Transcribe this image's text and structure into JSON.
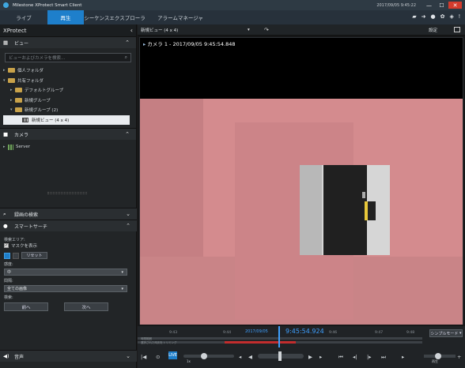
{
  "window": {
    "title": "Milestone XProtect Smart Client",
    "clock": "2017/09/05 9:45:22",
    "minimize_glyph": "—",
    "maximize_glyph": "☐",
    "close_glyph": "✕"
  },
  "tabs": [
    "ライブ",
    "再生",
    "シーケンスエクスプローラ",
    "アラームマネージャ"
  ],
  "active_tab": "再生",
  "top_icons": [
    "layout-icon",
    "arrow-icon",
    "help-icon",
    "gear-icon",
    "status-icon",
    "info-icon"
  ],
  "sidebar": {
    "title": "XProtect",
    "collapse_glyph": "‹",
    "views": {
      "header": "ビュー",
      "search_placeholder": "ビューおよびカメラを検索...",
      "tree": [
        {
          "label": "個人フォルダ",
          "level": 0
        },
        {
          "label": "共有フォルダ",
          "level": 0
        },
        {
          "label": "デフォルトグループ",
          "level": 1
        },
        {
          "label": "新規グループ",
          "level": 1
        },
        {
          "label": "新規グループ (2)",
          "level": 1
        },
        {
          "label": "新規ビュー (4 x 4)",
          "level": 2,
          "selected": true
        }
      ]
    },
    "cameras": {
      "header": "カメラ",
      "tree": [
        {
          "label": "Server",
          "level": 0
        }
      ]
    },
    "export": {
      "header": "録画の検索"
    },
    "smart_search": {
      "header": "スマートサーチ",
      "search_area_label": "検索エリア:",
      "show_mask_label": "マスクを表示",
      "show_mask_checked": true,
      "reset_label": "リセット",
      "sensitivity_label": "感度:",
      "sensitivity_value": "中",
      "interval_label": "間隔:",
      "interval_value": "全ての画像",
      "search_label": "検索:",
      "prev_label": "前へ",
      "next_label": "次へ"
    },
    "audio": {
      "header": "音声"
    }
  },
  "viewer": {
    "view_name": "新規ビュー (4 x 4)",
    "setup_label": "設定",
    "camera_title": "カメラ 1 - 2017/09/05 9:45:54.848"
  },
  "timeline": {
    "date": "2017/09/05",
    "time": "9:45:54.924",
    "ticks": [
      "9:43",
      "9:44",
      "9:46",
      "9:47",
      "9:48"
    ],
    "track1_label": "時間範囲",
    "track2_label": "選択された時刻をトリミング",
    "mode_button": "シンプルモード",
    "speed_label": "1x",
    "volume_label": "再生",
    "live_label": "LIVE"
  },
  "colors": {
    "accent": "#1e7fcb",
    "mask": "#d48b8e",
    "playhead": "#3ea0ff"
  }
}
